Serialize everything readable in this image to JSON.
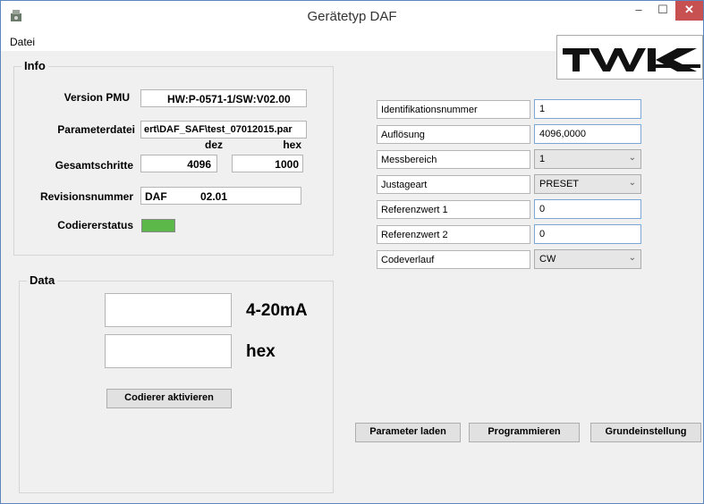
{
  "window": {
    "title": "Gerätetyp  DAF",
    "minimize": "–",
    "maximize": "☐",
    "close": "✕"
  },
  "menu": {
    "file": "Datei"
  },
  "logo": {
    "text": "TWK"
  },
  "info": {
    "title": "Info",
    "version_label": "Version PMU",
    "version_value": "HW:P-0571-1/SW:V02.00",
    "param_file_label": "Parameterdatei",
    "param_file_value": "ert\\DAF_SAF\\test_07012015.par",
    "dez_label": "dez",
    "hex_label": "hex",
    "steps_label": "Gesamtschritte",
    "steps_dez": "4096",
    "steps_hex": "1000",
    "revision_label": "Revisionsnummer",
    "revision_type": "DAF",
    "revision_value": "02.01",
    "coder_status_label": "Codiererstatus",
    "coder_status_color": "#5cb848"
  },
  "data": {
    "title": "Data",
    "unit_current": "4-20mA",
    "unit_hex": "hex",
    "activate_button": "Codierer aktivieren"
  },
  "params": {
    "id_label": "Identifikationsnummer",
    "id_value": "1",
    "resolution_label": "Auflösung",
    "resolution_value": "4096,0000",
    "range_label": "Messbereich",
    "range_value": "1",
    "adjust_label": "Justageart",
    "adjust_value": "PRESET",
    "ref1_label": "Referenzwert 1",
    "ref1_value": "0",
    "ref2_label": "Referenzwert 2",
    "ref2_value": "0",
    "code_label": "Codeverlauf",
    "code_value": "CW"
  },
  "buttons": {
    "load": "Parameter laden",
    "program": "Programmieren",
    "default": "Grundeinstellung"
  }
}
